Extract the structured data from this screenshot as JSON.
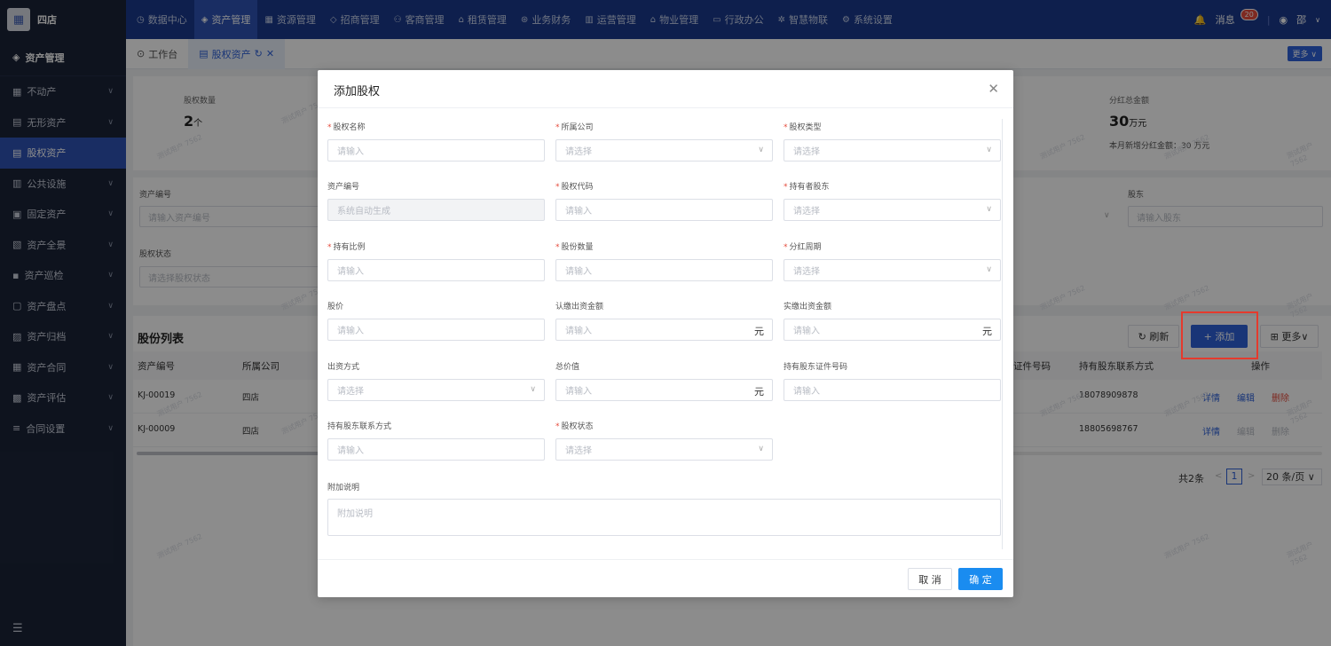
{
  "app": {
    "logo_text": "四店",
    "logo_icon": "building-icon"
  },
  "topnav": [
    {
      "label": "数据中心",
      "icon": "clock-icon"
    },
    {
      "label": "资产管理",
      "icon": "cube-icon",
      "active": true
    },
    {
      "label": "资源管理",
      "icon": "building-icon"
    },
    {
      "label": "招商管理",
      "icon": "diamond-icon"
    },
    {
      "label": "客商管理",
      "icon": "people-icon"
    },
    {
      "label": "租赁管理",
      "icon": "home-icon"
    },
    {
      "label": "业务财务",
      "icon": "money-icon"
    },
    {
      "label": "运营管理",
      "icon": "chart-icon"
    },
    {
      "label": "物业管理",
      "icon": "house-icon"
    },
    {
      "label": "行政办公",
      "icon": "monitor-icon"
    },
    {
      "label": "智慧物联",
      "icon": "network-icon"
    },
    {
      "label": "系统设置",
      "icon": "gear-icon"
    }
  ],
  "topright": {
    "messages_label": "消息",
    "messages_count": "20",
    "user": "邵"
  },
  "sidebar": {
    "header": "资产管理",
    "items": [
      {
        "label": "不动产",
        "icon": "building-icon"
      },
      {
        "label": "无形资产",
        "icon": "doc-icon"
      },
      {
        "label": "股权资产",
        "icon": "equity-icon",
        "active": true
      },
      {
        "label": "公共设施",
        "icon": "facility-icon"
      },
      {
        "label": "固定资产",
        "icon": "asset-icon"
      },
      {
        "label": "资产全景",
        "icon": "panorama-icon"
      },
      {
        "label": "资产巡检",
        "icon": "inspect-icon"
      },
      {
        "label": "资产盘点",
        "icon": "inventory-icon"
      },
      {
        "label": "资产归档",
        "icon": "archive-icon"
      },
      {
        "label": "资产合同",
        "icon": "contract-icon"
      },
      {
        "label": "资产评估",
        "icon": "assess-icon"
      },
      {
        "label": "合同设置",
        "icon": "settings-icon"
      }
    ]
  },
  "tabs": {
    "workbench": "工作台",
    "equity": "股权资产",
    "more": "更多"
  },
  "stats": {
    "count_label": "股权数量",
    "count_value": "2",
    "count_unit": "个",
    "dividend_label": "分红总金额",
    "dividend_value": "30",
    "dividend_unit": "万元",
    "dividend_sub": "本月新增分红金额：30 万元"
  },
  "filters": {
    "asset_no_label": "资产编号",
    "asset_no_placeholder": "请输入资产编号",
    "status_label": "股权状态",
    "status_placeholder": "请选择股权状态",
    "shareholder_label": "股东",
    "shareholder_placeholder": "请输入股东"
  },
  "list": {
    "title": "股份列表",
    "refresh": "刷新",
    "add": "+ 添加",
    "more": "更多",
    "columns": {
      "asset_no": "资产编号",
      "company": "所属公司",
      "cert": "证件号码",
      "contact": "持有股东联系方式",
      "ops": "操作"
    },
    "rows": [
      {
        "asset_no": "KJ-00019",
        "company": "四店",
        "contact": "18078909878",
        "detail": "详情",
        "edit": "编辑",
        "delete": "删除"
      },
      {
        "asset_no": "KJ-00009",
        "company": "四店",
        "contact": "18805698767",
        "detail": "详情",
        "edit": "编辑",
        "delete": "删除"
      }
    ],
    "pager": {
      "total": "共2条",
      "page": "1",
      "size": "20 条/页"
    }
  },
  "watermark": "测试用户 7562",
  "modal": {
    "title": "添加股权",
    "fields": {
      "name": {
        "label": "股权名称",
        "placeholder": "请输入",
        "required": true
      },
      "company": {
        "label": "所属公司",
        "placeholder": "请选择",
        "required": true
      },
      "type": {
        "label": "股权类型",
        "placeholder": "请选择",
        "required": true
      },
      "asset_no": {
        "label": "资产编号",
        "placeholder": "系统自动生成"
      },
      "code": {
        "label": "股权代码",
        "placeholder": "请输入",
        "required": true
      },
      "holder": {
        "label": "持有者股东",
        "placeholder": "请选择",
        "required": true
      },
      "ratio": {
        "label": "持有比例",
        "placeholder": "请输入",
        "required": true
      },
      "shares": {
        "label": "股份数量",
        "placeholder": "请输入",
        "required": true
      },
      "cycle": {
        "label": "分红周期",
        "placeholder": "请选择",
        "required": true
      },
      "price": {
        "label": "股价",
        "placeholder": "请输入"
      },
      "subscribed": {
        "label": "认缴出资金额",
        "placeholder": "请输入",
        "suffix": "元"
      },
      "paid": {
        "label": "实缴出资金额",
        "placeholder": "请输入",
        "suffix": "元"
      },
      "method": {
        "label": "出资方式",
        "placeholder": "请选择"
      },
      "total": {
        "label": "总价值",
        "placeholder": "请输入",
        "suffix": "元"
      },
      "cert": {
        "label": "持有股东证件号码",
        "placeholder": "请输入"
      },
      "contact": {
        "label": "持有股东联系方式",
        "placeholder": "请输入"
      },
      "status": {
        "label": "股权状态",
        "placeholder": "请选择",
        "required": true
      },
      "note": {
        "label": "附加说明",
        "placeholder": "附加说明"
      }
    },
    "cancel": "取 消",
    "confirm": "确 定"
  }
}
